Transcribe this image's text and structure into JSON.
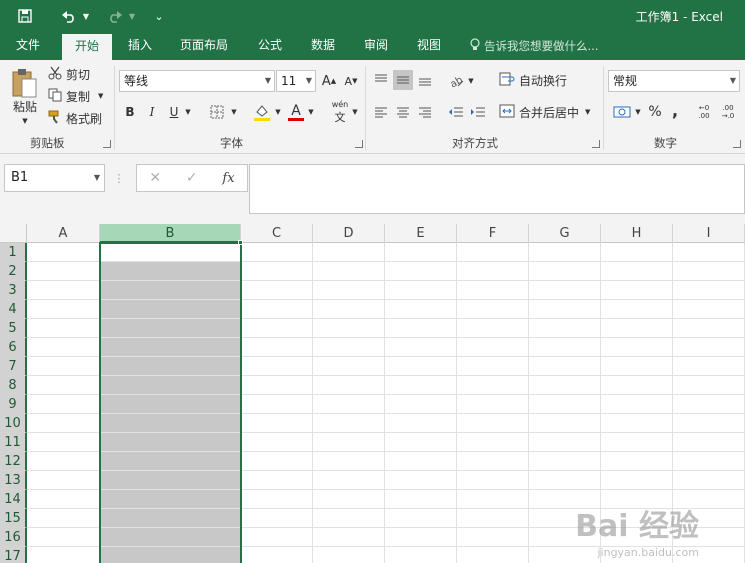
{
  "title_bar": {
    "title": "工作簿1 - Excel",
    "qa_more": "⌄"
  },
  "tabs": [
    {
      "label": "文件"
    },
    {
      "label": "开始"
    },
    {
      "label": "插入"
    },
    {
      "label": "页面布局"
    },
    {
      "label": "公式"
    },
    {
      "label": "数据"
    },
    {
      "label": "审阅"
    },
    {
      "label": "视图"
    }
  ],
  "tell_me": "告诉我您想要做什么...",
  "clipboard": {
    "paste": "粘贴",
    "cut": "剪切",
    "copy": "复制",
    "format_painter": "格式刷",
    "group": "剪贴板"
  },
  "font": {
    "name": "等线",
    "size": "11",
    "grow": "A",
    "shrink": "A",
    "bold": "B",
    "italic": "I",
    "underline": "U",
    "font_color": "A",
    "phonetic": "wén",
    "group": "字体"
  },
  "alignment": {
    "wrap": "自动换行",
    "merge": "合并后居中",
    "group": "对齐方式"
  },
  "number": {
    "format": "常规",
    "percent": "%",
    "comma": ",",
    "group": "数字"
  },
  "formula_bar": {
    "name_box": "B1",
    "cancel": "✕",
    "enter": "✓",
    "fx": "fx",
    "value": ""
  },
  "columns": [
    "A",
    "B",
    "C",
    "D",
    "E",
    "F",
    "G",
    "H",
    "I"
  ],
  "rows": [
    "1",
    "2",
    "3",
    "4",
    "5",
    "6",
    "7",
    "8",
    "9",
    "10",
    "11",
    "12",
    "13",
    "14",
    "15",
    "16",
    "17"
  ],
  "selection": {
    "column": "B",
    "active_cell": "B1"
  },
  "watermark": {
    "text": "Bai 经验",
    "sub": "jingyan.baidu.com"
  },
  "colors": {
    "accent": "#217346",
    "selection_fill": "#c8c8c8",
    "ribbon_bg": "#f3f3f3"
  }
}
